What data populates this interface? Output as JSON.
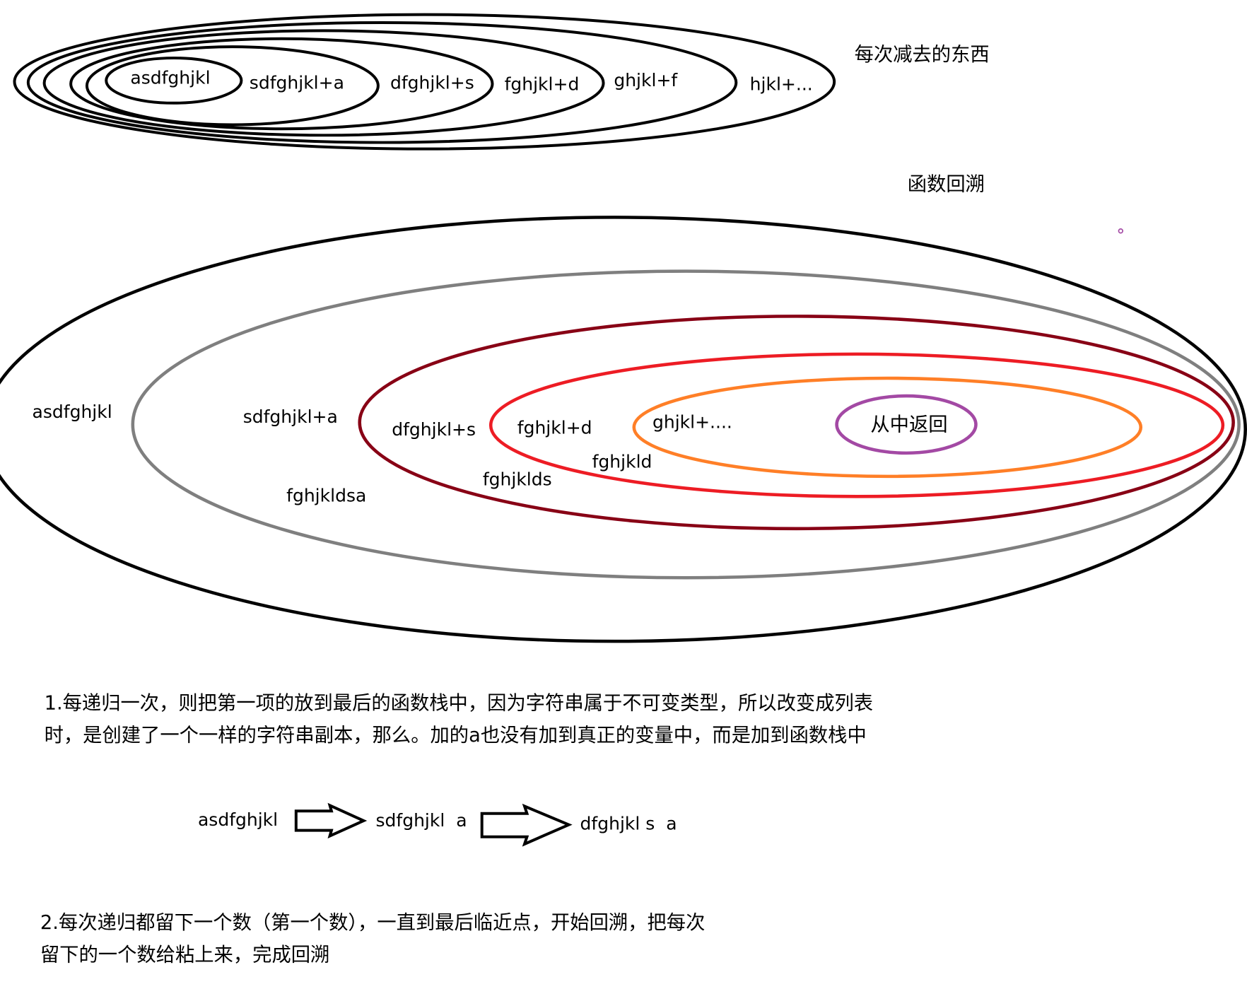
{
  "top_diagram": {
    "caption": "每次减去的东西",
    "rings": [
      {
        "label": "asdfghjkl"
      },
      {
        "label": "sdfghjkl+a"
      },
      {
        "label": "dfghjkl+s"
      },
      {
        "label": "fghjkl+d"
      },
      {
        "label": "ghjkl+f"
      },
      {
        "label": "hjkl+..."
      }
    ]
  },
  "bottom_diagram": {
    "caption": "函数回溯",
    "caption_color": "#ff7f27",
    "rings": [
      {
        "label": "asdfghjkl",
        "color": "#000000"
      },
      {
        "label": "sdfghjkl+a",
        "color": "#7f7f7f"
      },
      {
        "label": "dfghjkl+s",
        "color": "#880015"
      },
      {
        "label": "fghjkl+d",
        "color": "#ed1c24"
      },
      {
        "label": "ghjkl+....",
        "color": "#ff7f27"
      },
      {
        "label": "从中返回",
        "color": "#a349a4"
      }
    ],
    "return_labels": [
      {
        "label": "fghjkld",
        "color": "#a349a4"
      },
      {
        "label": "fghjklds",
        "color": "#00a2e8"
      },
      {
        "label": "fghjkldsa",
        "color": "#ffc90e"
      }
    ]
  },
  "note_1": {
    "lines": [
      "1.每递归一次，则把第一项的放到最后的函数栈中，因为字符串属于不可变类型，所以改变成列表",
      "时，是创建了一个一样的字符串副本，那么。加的a也没有加到真正的变量中，而是加到函数栈中"
    ]
  },
  "flow": {
    "steps": [
      "asdfghjkl",
      "sdfghjkl  a",
      "dfghjkl s  a"
    ]
  },
  "note_2": {
    "lines": [
      "2.每次递归都留下一个数（第一个数），一直到最后临近点，开始回溯，把每次",
      "留下的一个数给粘上来，完成回溯"
    ]
  }
}
